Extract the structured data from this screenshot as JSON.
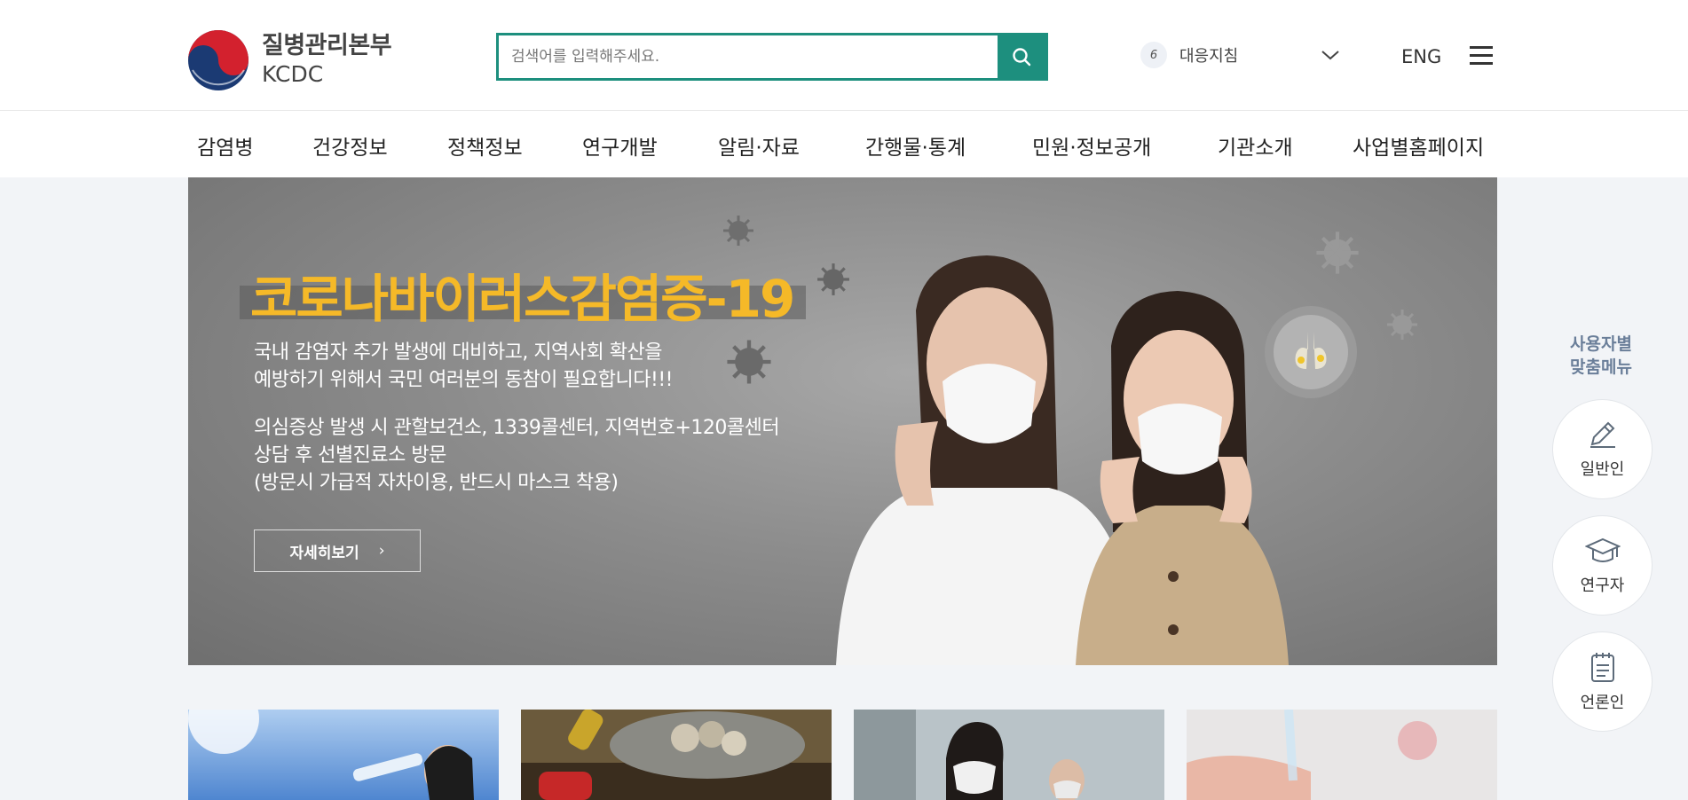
{
  "header": {
    "logo": {
      "name_ko": "질병관리본부",
      "name_en": "KCDC"
    },
    "search": {
      "placeholder": "검색어를 입력해주세요.",
      "button_icon": "search-icon"
    },
    "guide": {
      "number": "6",
      "label": "대응지침",
      "icon": "chevron-down-icon"
    },
    "lang": "ENG",
    "menu_icon": "hamburger-icon"
  },
  "nav": {
    "items": [
      "감염병",
      "건강정보",
      "정책정보",
      "연구개발",
      "알림·자료",
      "간행물·통계",
      "민원·정보공개",
      "기관소개",
      "사업별홈페이지"
    ]
  },
  "banner": {
    "title": "코로나바이러스감염증-19",
    "desc1": "국내 감염자  추가 발생에 대비하고, 지역사회 확산을\n예방하기 위해서 국민 여러분의 동참이 필요합니다!!!",
    "desc2": "의심증상 발생 시 관할보건소, 1339콜센터, 지역번호+120콜센터\n상담 후 선별진료소 방문\n(방문시 가급적 자차이용, 반드시 마스크 착용)",
    "more_label": "자세히보기",
    "more_icon": "chevron-right-icon",
    "title_color": "#f5b928"
  },
  "quick_menu": {
    "title": "사용자별\n맞춤메뉴",
    "items": [
      {
        "label": "일반인",
        "icon": "pencil-icon"
      },
      {
        "label": "연구자",
        "icon": "graduation-cap-icon"
      },
      {
        "label": "언론인",
        "icon": "notepad-icon"
      }
    ]
  },
  "colors": {
    "brand": "#1d8f7e",
    "side_title": "#6a7e99"
  }
}
